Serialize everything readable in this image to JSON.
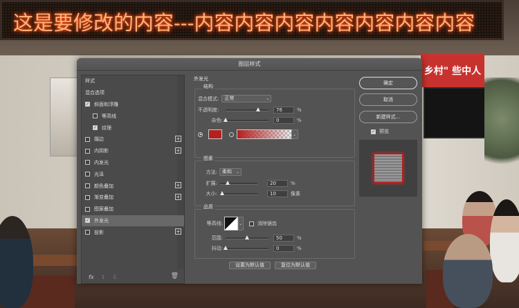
{
  "background": {
    "led_text": "这是要修改的内容---内容内容内容内容内容内容内容",
    "banner_fragment": "乡村\" 些中人"
  },
  "dialog": {
    "title": "图层样式",
    "styles_list": [
      {
        "label": "样式",
        "type": "header"
      },
      {
        "label": "混合选项",
        "type": "header"
      },
      {
        "label": "斜面和浮雕",
        "checked": true,
        "plus": false
      },
      {
        "label": "等高线",
        "checked": false,
        "sub": true
      },
      {
        "label": "纹理",
        "checked": true,
        "sub": true
      },
      {
        "label": "描边",
        "checked": false,
        "plus": true
      },
      {
        "label": "内阴影",
        "checked": false,
        "plus": true
      },
      {
        "label": "内发光",
        "checked": false,
        "plus": false
      },
      {
        "label": "光泽",
        "checked": false,
        "plus": false
      },
      {
        "label": "颜色叠加",
        "checked": false,
        "plus": true
      },
      {
        "label": "渐变叠加",
        "checked": false,
        "plus": true
      },
      {
        "label": "图案叠加",
        "checked": false,
        "plus": false
      },
      {
        "label": "外发光",
        "checked": true,
        "plus": false,
        "selected": true
      },
      {
        "label": "投影",
        "checked": false,
        "plus": true
      }
    ],
    "footer": {
      "fx": "fx",
      "up": "⇧",
      "down": "⇩",
      "trash": "🗑"
    },
    "outer_glow": {
      "title": "外发光",
      "structure": {
        "title": "结构",
        "blend_mode_label": "混合模式:",
        "blend_mode_value": "正常",
        "opacity_label": "不透明度:",
        "opacity_value": "76",
        "opacity_unit": "%",
        "opacity_fraction": 0.76,
        "noise_label": "杂色:",
        "noise_value": "0",
        "noise_unit": "%",
        "glow_color": "#b3201f"
      },
      "elements": {
        "title": "图素",
        "technique_label": "方法:",
        "technique_value": "柔和",
        "spread_label": "扩展:",
        "spread_value": "20",
        "spread_unit": "%",
        "size_label": "大小:",
        "size_value": "10",
        "size_unit": "像素"
      },
      "quality": {
        "title": "品质",
        "contour_label": "等高线:",
        "antialias_label": "消除锯齿",
        "range_label": "范围:",
        "range_value": "50",
        "range_unit": "%",
        "jitter_label": "抖动:",
        "jitter_value": "0",
        "jitter_unit": "%"
      },
      "set_default": "设置为默认值",
      "reset_default": "复位为默认值"
    },
    "buttons": {
      "ok": "确定",
      "cancel": "取消",
      "new_style": "新建样式...",
      "preview": "预览"
    }
  }
}
